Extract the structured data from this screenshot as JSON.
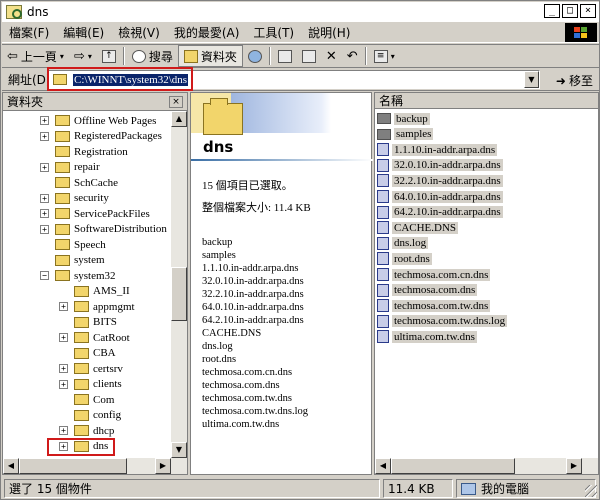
{
  "window": {
    "title": "dns"
  },
  "menu": [
    "檔案(F)",
    "編輯(E)",
    "檢視(V)",
    "我的最愛(A)",
    "工具(T)",
    "說明(H)"
  ],
  "toolbar": {
    "back": "上一頁",
    "search": "搜尋",
    "folders": "資料夾"
  },
  "address": {
    "label": "網址(D)",
    "value": "C:\\WINNT\\system32\\dns",
    "go": "移至"
  },
  "left_pane": {
    "title": "資料夾",
    "close": "×",
    "tree": [
      {
        "label": "Offline Web Pages",
        "expander": "+"
      },
      {
        "label": "RegisteredPackages",
        "expander": "+"
      },
      {
        "label": "Registration",
        "expander": ""
      },
      {
        "label": "repair",
        "expander": "+"
      },
      {
        "label": "SchCache",
        "expander": ""
      },
      {
        "label": "security",
        "expander": "+"
      },
      {
        "label": "ServicePackFiles",
        "expander": "+"
      },
      {
        "label": "SoftwareDistribution",
        "expander": "+"
      },
      {
        "label": "Speech",
        "expander": ""
      },
      {
        "label": "system",
        "expander": ""
      },
      {
        "label": "system32",
        "expander": "−"
      },
      {
        "label": "AMS_II",
        "expander": ""
      },
      {
        "label": "appmgmt",
        "expander": "+"
      },
      {
        "label": "BITS",
        "expander": ""
      },
      {
        "label": "CatRoot",
        "expander": "+"
      },
      {
        "label": "CBA",
        "expander": ""
      },
      {
        "label": "certsrv",
        "expander": "+"
      },
      {
        "label": "clients",
        "expander": "+"
      },
      {
        "label": "Com",
        "expander": ""
      },
      {
        "label": "config",
        "expander": ""
      },
      {
        "label": "dhcp",
        "expander": "+"
      },
      {
        "label": "dns",
        "expander": "+"
      }
    ]
  },
  "middle_pane": {
    "folder_name": "dns",
    "selected_count": "15 個項目已選取。",
    "total_size": "整個檔案大小: 11.4 KB",
    "files": [
      "backup",
      "samples",
      "1.1.10.in-addr.arpa.dns",
      "32.0.10.in-addr.arpa.dns",
      "32.2.10.in-addr.arpa.dns",
      "64.0.10.in-addr.arpa.dns",
      "64.2.10.in-addr.arpa.dns",
      "CACHE.DNS",
      "dns.log",
      "root.dns",
      "techmosa.com.cn.dns",
      "techmosa.com.dns",
      "techmosa.com.tw.dns",
      "techmosa.com.tw.dns.log",
      "ultima.com.tw.dns"
    ]
  },
  "right_pane": {
    "column_header": "名稱",
    "items": [
      {
        "name": "backup",
        "icon": "folder-icon"
      },
      {
        "name": "samples",
        "icon": "folder-icon"
      },
      {
        "name": "1.1.10.in-addr.arpa.dns",
        "icon": "file-icon"
      },
      {
        "name": "32.0.10.in-addr.arpa.dns",
        "icon": "file-icon"
      },
      {
        "name": "32.2.10.in-addr.arpa.dns",
        "icon": "file-icon"
      },
      {
        "name": "64.0.10.in-addr.arpa.dns",
        "icon": "file-icon"
      },
      {
        "name": "64.2.10.in-addr.arpa.dns",
        "icon": "file-icon"
      },
      {
        "name": "CACHE.DNS",
        "icon": "file-icon"
      },
      {
        "name": "dns.log",
        "icon": "file-icon"
      },
      {
        "name": "root.dns",
        "icon": "file-icon"
      },
      {
        "name": "techmosa.com.cn.dns",
        "icon": "file-icon"
      },
      {
        "name": "techmosa.com.dns",
        "icon": "file-icon"
      },
      {
        "name": "techmosa.com.tw.dns",
        "icon": "file-icon"
      },
      {
        "name": "techmosa.com.tw.dns.log",
        "icon": "file-icon"
      },
      {
        "name": "ultima.com.tw.dns",
        "icon": "file-icon"
      }
    ]
  },
  "status": {
    "selection": "選了 15 個物件",
    "size": "11.4 KB",
    "location": "我的電腦"
  },
  "colors": {
    "highlight": "#0a246a",
    "annotation_red": "#d01a1a",
    "face": "#d4d0c8"
  }
}
